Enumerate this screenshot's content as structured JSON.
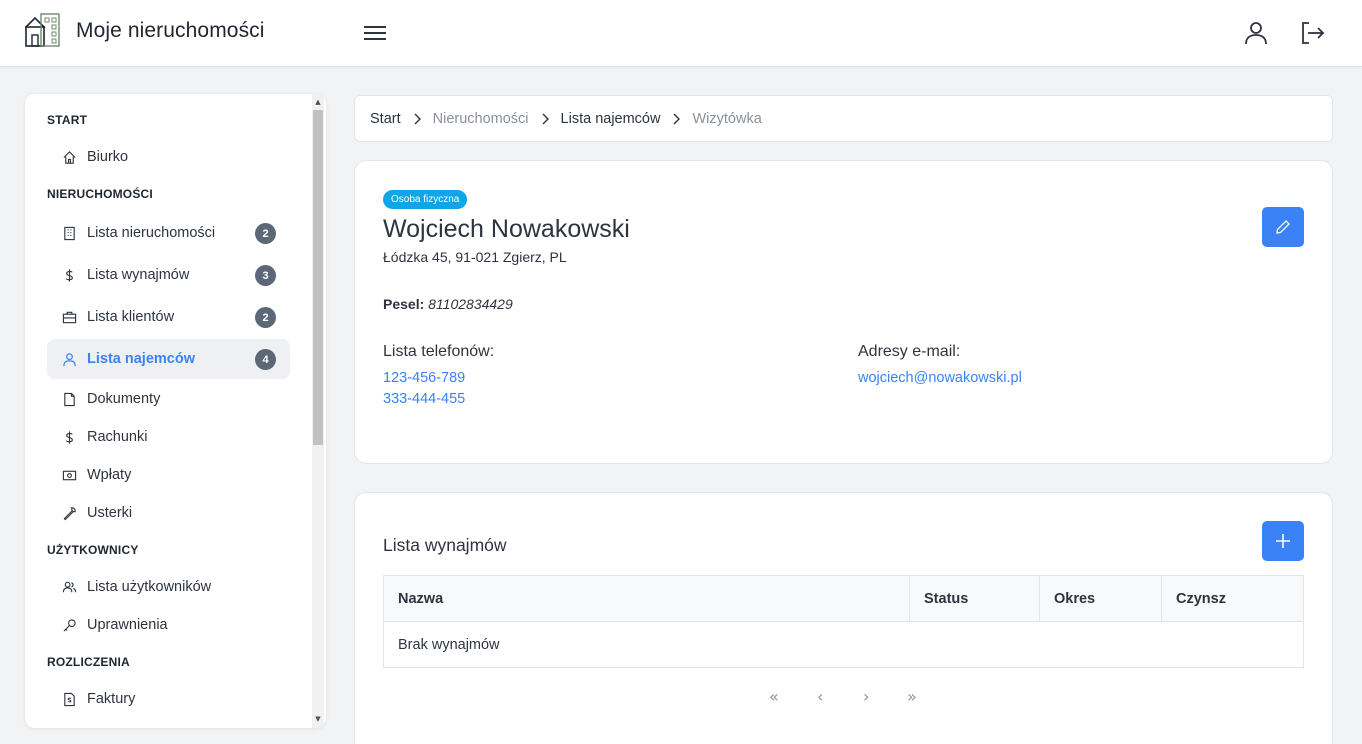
{
  "app": {
    "title": "Moje nieruchomości"
  },
  "sidebar": {
    "sections": [
      {
        "label": "START"
      },
      {
        "label": "NIERUCHOMOŚCI"
      },
      {
        "label": "UŻYTKOWNICY"
      },
      {
        "label": "ROZLICZENIA"
      }
    ],
    "items": [
      {
        "label": "Biurko",
        "icon": "home-icon"
      },
      {
        "label": "Lista nieruchomości",
        "icon": "building-icon",
        "badge": "2"
      },
      {
        "label": "Lista wynajmów",
        "icon": "dollar-icon",
        "badge": "3"
      },
      {
        "label": "Lista klientów",
        "icon": "briefcase-icon",
        "badge": "2"
      },
      {
        "label": "Lista najemców",
        "icon": "user-icon",
        "badge": "4",
        "active": true
      },
      {
        "label": "Dokumenty",
        "icon": "document-icon"
      },
      {
        "label": "Rachunki",
        "icon": "dollar-icon"
      },
      {
        "label": "Wpłaty",
        "icon": "cash-icon"
      },
      {
        "label": "Usterki",
        "icon": "wrench-icon"
      },
      {
        "label": "Lista użytkowników",
        "icon": "users-icon"
      },
      {
        "label": "Uprawnienia",
        "icon": "key-icon"
      },
      {
        "label": "Faktury",
        "icon": "invoice-icon"
      }
    ]
  },
  "breadcrumb": [
    "Start",
    "Nieruchomości",
    "Lista najemców",
    "Wizytówka"
  ],
  "tenant": {
    "type": "Osoba fizyczna",
    "name": "Wojciech Nowakowski",
    "address": "Łódzka 45, 91-021 Zgierz, PL",
    "pesel_label": "Pesel:",
    "pesel": "81102834429",
    "phones_label": "Lista telefonów:",
    "phones": [
      "123-456-789",
      "333-444-455"
    ],
    "emails_label": "Adresy e-mail:",
    "emails": [
      "wojciech@nowakowski.pl"
    ]
  },
  "rentals": {
    "title": "Lista wynajmów",
    "columns": [
      "Nazwa",
      "Status",
      "Okres",
      "Czynsz"
    ],
    "empty": "Brak wynajmów",
    "pager": [
      "«",
      "‹",
      "›",
      "»"
    ]
  },
  "colors": {
    "accent": "#3b82f6",
    "pill": "#0ea5e9",
    "badge": "#5c6777"
  }
}
